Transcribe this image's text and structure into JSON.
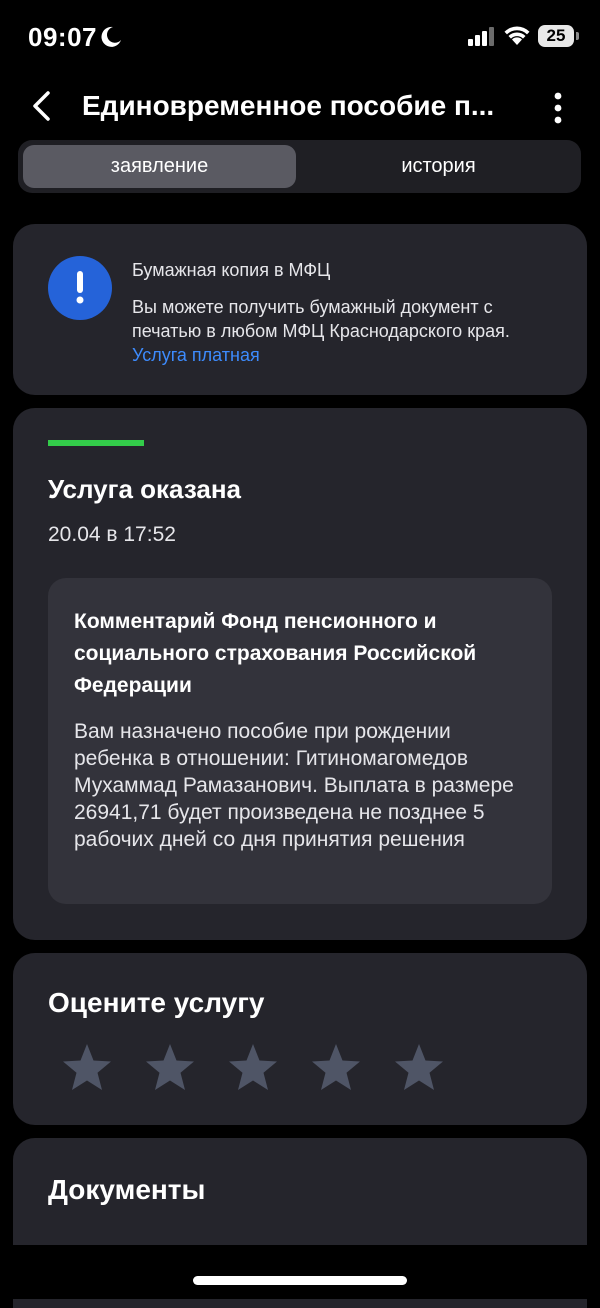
{
  "status_bar": {
    "time": "09:07",
    "battery": "25"
  },
  "header": {
    "title": "Единовременное пособие п..."
  },
  "tabs": [
    {
      "label": "заявление",
      "active": true
    },
    {
      "label": "история",
      "active": false
    }
  ],
  "notice": {
    "title": "Бумажная копия в МФЦ",
    "body": "Вы можете получить бумажный документ с печатью в любом МФЦ Краснодарского края.",
    "link": "Услуга платная"
  },
  "status": {
    "title": "Услуга оказана",
    "date": "20.04 в 17:52",
    "comment_title": "Комментарий Фонд пенсионного и социального страхования Российской Федерации",
    "comment_text": "Вам назначено пособие при рождении ребенка в отношении: Гитиномагомедов Мухаммад Рамазанович. Выплата в размере 26941,71 будет произведена не позднее 5 рабочих дней со дня принятия решения",
    "progress_color": "#33cc4a"
  },
  "rating": {
    "title": "Оцените услугу",
    "max_stars": 5,
    "value": 0
  },
  "documents": {
    "title": "Документы"
  },
  "colors": {
    "accent_blue": "#2563d9",
    "link_blue": "#3d8bfd",
    "card_bg": "#25252c",
    "star_color": "#4f5566"
  }
}
